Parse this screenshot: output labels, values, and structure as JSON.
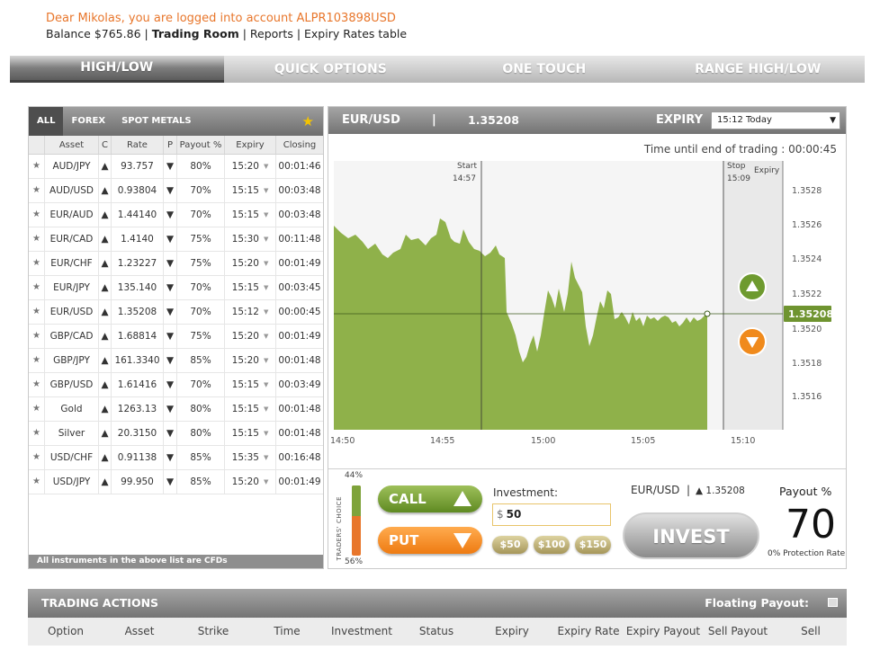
{
  "account": {
    "welcome": "Dear Mikolas, you are logged into account ALPR103898USD",
    "balance": "Balance $765.86",
    "links": [
      "Trading Room",
      "Reports",
      "Expiry Rates table"
    ]
  },
  "main_tabs": [
    "HIGH/LOW",
    "QUICK OPTIONS",
    "ONE TOUCH",
    "RANGE HIGH/LOW"
  ],
  "asset_tabs": [
    "ALL",
    "FOREX",
    "SPOT METALS"
  ],
  "asset_columns": [
    "Asset",
    "C",
    "Rate",
    "P",
    "Payout %",
    "Expiry",
    "Closing"
  ],
  "assets": [
    {
      "asset": "AUD/JPY",
      "rate": "93.757",
      "payout": "80%",
      "expiry": "15:20",
      "closing": "00:01:46"
    },
    {
      "asset": "AUD/USD",
      "rate": "0.93804",
      "payout": "70%",
      "expiry": "15:15",
      "closing": "00:03:48"
    },
    {
      "asset": "EUR/AUD",
      "rate": "1.44140",
      "payout": "70%",
      "expiry": "15:15",
      "closing": "00:03:48"
    },
    {
      "asset": "EUR/CAD",
      "rate": "1.4140",
      "payout": "75%",
      "expiry": "15:30",
      "closing": "00:11:48"
    },
    {
      "asset": "EUR/CHF",
      "rate": "1.23227",
      "payout": "75%",
      "expiry": "15:20",
      "closing": "00:01:49"
    },
    {
      "asset": "EUR/JPY",
      "rate": "135.140",
      "payout": "70%",
      "expiry": "15:15",
      "closing": "00:03:45"
    },
    {
      "asset": "EUR/USD",
      "rate": "1.35208",
      "payout": "70%",
      "expiry": "15:12",
      "closing": "00:00:45"
    },
    {
      "asset": "GBP/CAD",
      "rate": "1.68814",
      "payout": "75%",
      "expiry": "15:20",
      "closing": "00:01:49"
    },
    {
      "asset": "GBP/JPY",
      "rate": "161.3340",
      "payout": "85%",
      "expiry": "15:20",
      "closing": "00:01:48"
    },
    {
      "asset": "GBP/USD",
      "rate": "1.61416",
      "payout": "70%",
      "expiry": "15:15",
      "closing": "00:03:49"
    },
    {
      "asset": "Gold",
      "rate": "1263.13",
      "payout": "80%",
      "expiry": "15:15",
      "closing": "00:01:48"
    },
    {
      "asset": "Silver",
      "rate": "20.3150",
      "payout": "80%",
      "expiry": "15:15",
      "closing": "00:01:48"
    },
    {
      "asset": "USD/CHF",
      "rate": "0.91138",
      "payout": "85%",
      "expiry": "15:35",
      "closing": "00:16:48"
    },
    {
      "asset": "USD/JPY",
      "rate": "99.950",
      "payout": "85%",
      "expiry": "15:20",
      "closing": "00:01:49"
    }
  ],
  "cfd_note": "All instruments in the above list are CFDs",
  "chart_header": {
    "asset": "EUR/USD",
    "separator": "|",
    "rate": "1.35208",
    "expiry_label": "EXPIRY",
    "expiry_value": "15:12 Today"
  },
  "time_left": "Time until end of trading : 00:00:45",
  "chart": {
    "start_label": "Start",
    "start_time": "14:57",
    "stop_label": "Stop",
    "stop_time": "15:09",
    "expiry_label": "Expiry",
    "y_ticks": [
      "1.3528",
      "1.3526",
      "1.3524",
      "1.3522",
      "1.3520",
      "1.3518",
      "1.3516"
    ],
    "x_ticks": [
      "14:50",
      "14:55",
      "15:00",
      "15:05",
      "15:10"
    ],
    "current_rate": "1.35208",
    "fill_color": "#8fb14a"
  },
  "traders_choice": {
    "top": "44%",
    "bottom": "56%",
    "label": "TRADERS' CHOICE",
    "call_share": 0.44
  },
  "trade": {
    "call_label": "CALL",
    "put_label": "PUT",
    "investment_label": "Investment:",
    "currency": "$",
    "investment_value": "50",
    "quick_amounts": [
      "$50",
      "$100",
      "$150"
    ],
    "asset": "EUR/USD",
    "rate": "▲ 1.35208",
    "invest_label": "INVEST",
    "payout_label": "Payout %",
    "payout_value": "70",
    "protection": "0% Protection Rate"
  },
  "actions": {
    "title": "TRADING ACTIONS",
    "floating": "Floating Payout:",
    "columns": [
      "Option",
      "Asset",
      "Strike",
      "Time",
      "Investment",
      "Status",
      "Expiry",
      "Expiry Rate",
      "Expiry Payout",
      "Sell Payout",
      "Sell"
    ]
  }
}
